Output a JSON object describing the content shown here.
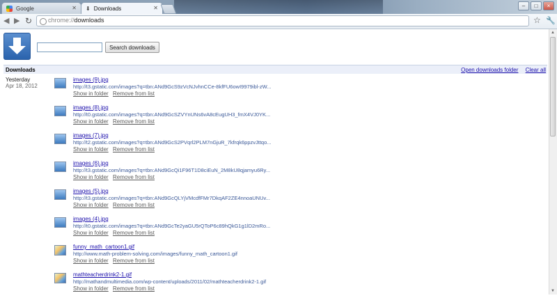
{
  "window": {
    "tabs": [
      {
        "label": "Google",
        "active": false
      },
      {
        "label": "Downloads",
        "active": true
      }
    ],
    "controls": [
      "–",
      "□",
      "×"
    ]
  },
  "toolbar": {
    "url_scheme": "chrome://",
    "url_path": "downloads"
  },
  "page": {
    "search_placeholder": "",
    "search_button": "Search downloads",
    "section_title": "Downloads",
    "open_folder_link": "Open downloads folder",
    "clear_all_link": "Clear all",
    "date_label": "Yesterday",
    "date_full": "Apr 18, 2012"
  },
  "downloads": [
    {
      "name": "images (9).jpg",
      "url": "http://t3.gstatic.com/images?q=tbn:ANd9GcS9zVcNJvhnCCe-8kfFU6owI9979ibl-zW...",
      "type": "jpg"
    },
    {
      "name": "images (8).jpg",
      "url": "http://t0.gstatic.com/images?q=tbn:ANd9GcSZVYnUNs6vA8cEugUH3_fmX4VJ0YK...",
      "type": "jpg"
    },
    {
      "name": "images (7).jpg",
      "url": "http://t2.gstatic.com/images?q=tbn:ANd9GcS2PVqrl2PLM7nGjuR_7kfrqk6ppzvJttqo...",
      "type": "jpg"
    },
    {
      "name": "images (6).jpg",
      "url": "http://t3.gstatic.com/images?q=tbn:ANd9GcQi1F96T1D8ciEuN_2M8kU8qjamyu6Ry...",
      "type": "jpg"
    },
    {
      "name": "images (5).jpg",
      "url": "http://t3.gstatic.com/images?q=tbn:ANd9GcQLYjVMcdfFMr7DkqAF2ZE4nnoaUNUv...",
      "type": "jpg"
    },
    {
      "name": "images (4).jpg",
      "url": "http://t0.gstatic.com/images?q=tbn:ANd9GcTe2yaGU5rQToP6c89hQkG1g1lD2mRo...",
      "type": "jpg"
    },
    {
      "name": "funny_math_cartoon1.gif",
      "url": "http://www.math-problem-solving.com/images/funny_math_cartoon1.gif",
      "type": "gif"
    },
    {
      "name": "mathteacherdrink2-1.gif",
      "url": "http://mathandmultimedia.com/wp-content/uploads/2011/02/mathteacherdrink2-1.gif",
      "type": "gif"
    }
  ],
  "actions": {
    "show": "Show in folder",
    "remove": "Remove from list"
  }
}
